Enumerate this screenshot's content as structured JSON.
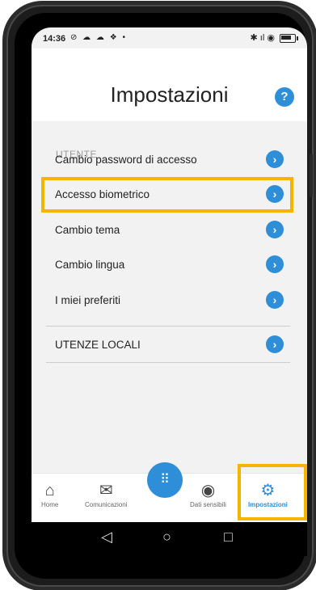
{
  "status_bar": {
    "time": "14:36",
    "left_icons": "⊘ ☁ ☁ ❖ •",
    "right_icons": "✱ ıl ◉"
  },
  "header": {
    "title": "Impostazioni",
    "help_icon": "?"
  },
  "sections": {
    "utente": {
      "label": "UTENTE",
      "items": [
        {
          "label": "Cambio password di accesso"
        },
        {
          "label": "Accesso biometrico"
        },
        {
          "label": "Cambio tema"
        },
        {
          "label": "Cambio lingua"
        },
        {
          "label": "I miei preferiti"
        }
      ]
    },
    "utenze_locali": {
      "label": "UTENZE LOCALI"
    }
  },
  "bottom_nav": {
    "items": [
      {
        "label": "Home",
        "icon": "home-icon"
      },
      {
        "label": "Comunicazioni",
        "icon": "mail-icon"
      },
      {
        "label": "Dati sensibili",
        "icon": "eye-icon"
      },
      {
        "label": "Impostazioni",
        "icon": "gear-icon"
      }
    ]
  },
  "colors": {
    "accent": "#2f8ed8",
    "highlight": "#f4b400"
  }
}
